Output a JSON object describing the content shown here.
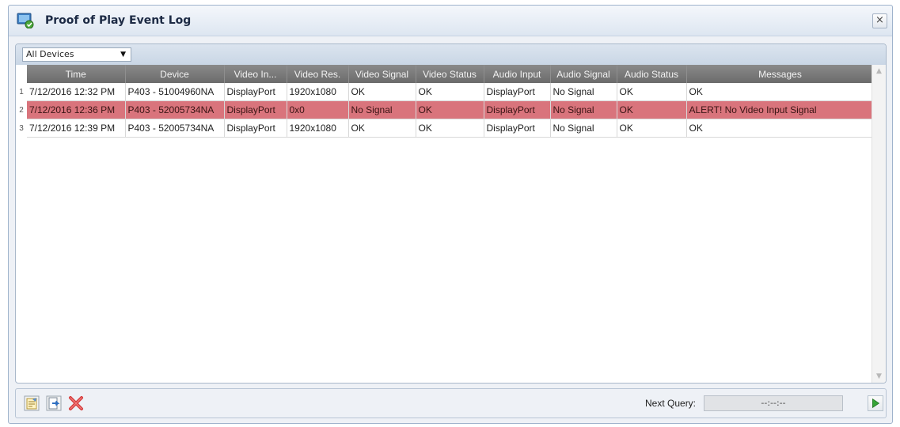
{
  "window": {
    "title": "Proof of Play Event Log",
    "close_glyph": "×"
  },
  "filter": {
    "selected": "All Devices",
    "arrow": "▼"
  },
  "table": {
    "columns": [
      "Time",
      "Device",
      "Video In...",
      "Video Res.",
      "Video Signal",
      "Video Status",
      "Audio Input",
      "Audio Signal",
      "Audio Status",
      "Messages"
    ],
    "rows": [
      {
        "num": "1",
        "cells": [
          "7/12/2016 12:32 PM",
          "P403 - 51004960NA",
          "DisplayPort",
          "1920x1080",
          "OK",
          "OK",
          "DisplayPort",
          "No Signal",
          "OK",
          "OK"
        ],
        "alert": false
      },
      {
        "num": "2",
        "cells": [
          "7/12/2016 12:36 PM",
          "P403 - 52005734NA",
          "DisplayPort",
          "0x0",
          "No Signal",
          "OK",
          "DisplayPort",
          "No Signal",
          "OK",
          "ALERT! No Video Input Signal"
        ],
        "alert": true
      },
      {
        "num": "3",
        "cells": [
          "7/12/2016 12:39 PM",
          "P403 - 52005734NA",
          "DisplayPort",
          "1920x1080",
          "OK",
          "OK",
          "DisplayPort",
          "No Signal",
          "OK",
          "OK"
        ],
        "alert": false
      }
    ]
  },
  "footer": {
    "next_query_label": "Next Query:",
    "next_query_value": "--:--:--",
    "tools": [
      "notes-icon",
      "export-icon",
      "delete-icon"
    ],
    "play": "play-icon"
  },
  "colors": {
    "alert_row": "#d9747c",
    "header": "#7a7a7a"
  }
}
